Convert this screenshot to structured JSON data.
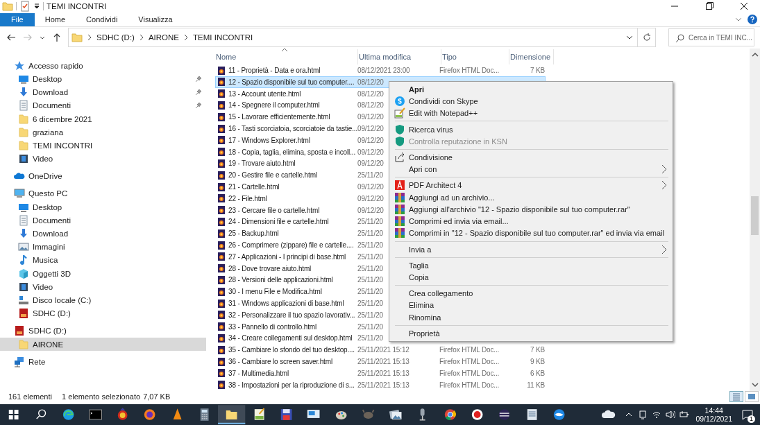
{
  "window": {
    "title": "TEMI INCONTRI"
  },
  "ribbon_tabs": [
    {
      "label": "File",
      "kind": "file"
    },
    {
      "label": "Home",
      "kind": "tab"
    },
    {
      "label": "Condividi",
      "kind": "tab"
    },
    {
      "label": "Visualizza",
      "kind": "tab"
    }
  ],
  "breadcrumb": [
    "SDHC (D:)",
    "AIRONE",
    "TEMI INCONTRI"
  ],
  "search": {
    "placeholder": "Cerca in TEMI INC..."
  },
  "sidebar": {
    "items": [
      {
        "label": "Accesso rapido",
        "kind": "star",
        "selected": false,
        "children": [
          {
            "label": "Desktop",
            "kind": "desktop",
            "selected": false,
            "pinned": true
          },
          {
            "label": "Download",
            "kind": "download",
            "selected": false,
            "pinned": true
          },
          {
            "label": "Documenti",
            "kind": "documents",
            "selected": false,
            "pinned": true
          },
          {
            "label": "6 dicembre 2021",
            "kind": "folder",
            "selected": false,
            "pinned": false
          },
          {
            "label": "graziana",
            "kind": "folder",
            "selected": false,
            "pinned": false
          },
          {
            "label": "TEMI INCONTRI",
            "kind": "folder",
            "selected": false,
            "pinned": false
          },
          {
            "label": "Video",
            "kind": "video",
            "selected": false,
            "pinned": false
          }
        ]
      },
      {
        "label": "OneDrive",
        "kind": "cloud",
        "selected": false
      },
      {
        "label": "Questo PC",
        "kind": "pc",
        "selected": false,
        "children": [
          {
            "label": "Desktop",
            "kind": "desktop",
            "selected": false
          },
          {
            "label": "Documenti",
            "kind": "documents",
            "selected": false
          },
          {
            "label": "Download",
            "kind": "download",
            "selected": false
          },
          {
            "label": "Immagini",
            "kind": "pictures",
            "selected": false
          },
          {
            "label": "Musica",
            "kind": "music",
            "selected": false
          },
          {
            "label": "Oggetti 3D",
            "kind": "cube",
            "selected": false
          },
          {
            "label": "Video",
            "kind": "video",
            "selected": false
          },
          {
            "label": "Disco locale (C:)",
            "kind": "disk",
            "selected": false
          },
          {
            "label": "SDHC (D:)",
            "kind": "sd",
            "selected": false
          }
        ]
      },
      {
        "label": "SDHC (D:)",
        "kind": "sd",
        "selected": false,
        "children": [
          {
            "label": "AIRONE",
            "kind": "folder",
            "selected": true
          }
        ]
      },
      {
        "label": "Rete",
        "kind": "network",
        "selected": false
      }
    ]
  },
  "table": {
    "columns": [
      "Nome",
      "Ultima modifica",
      "Tipo",
      "Dimensione"
    ],
    "rows": [
      {
        "name": "11 - Proprietà - Data e ora.html",
        "modified": "08/12/2021 23:00",
        "type": "Firefox HTML Doc...",
        "size": "7 KB",
        "selected": false
      },
      {
        "name": "12 - Spazio disponibile sul tuo computer....",
        "modified": "08/12/20",
        "selected": true
      },
      {
        "name": "13 - Account utente.html",
        "modified": "08/12/20",
        "selected": false
      },
      {
        "name": "14 - Spegnere il computer.html",
        "modified": "08/12/20",
        "selected": false
      },
      {
        "name": "15 - Lavorare efficientemente.html",
        "modified": "09/12/20",
        "selected": false
      },
      {
        "name": "16 - Tasti scorciatoia, scorciatoie da tastie...",
        "modified": "09/12/20",
        "selected": false
      },
      {
        "name": "17 - Windows Explorer.html",
        "modified": "09/12/20",
        "selected": false
      },
      {
        "name": "18 - Copia, taglia, elimina, sposta e incoll...",
        "modified": "09/12/20",
        "selected": false
      },
      {
        "name": "19 - Trovare aiuto.html",
        "modified": "09/12/20",
        "selected": false
      },
      {
        "name": "20 - Gestire file e cartelle.html",
        "modified": "25/11/20",
        "selected": false
      },
      {
        "name": "21 - Cartelle.html",
        "modified": "09/12/20",
        "selected": false
      },
      {
        "name": "22 - File.html",
        "modified": "09/12/20",
        "selected": false
      },
      {
        "name": "23 - Cercare file o cartelle.html",
        "modified": "09/12/20",
        "selected": false
      },
      {
        "name": "24 - Dimensioni file e cartelle.html",
        "modified": "25/11/20",
        "selected": false
      },
      {
        "name": "25 - Backup.html",
        "modified": "25/11/20",
        "selected": false
      },
      {
        "name": "26 - Comprimere (zippare) file e cartelle....",
        "modified": "25/11/20",
        "selected": false
      },
      {
        "name": "27 - Applicazioni - I principi di base.html",
        "modified": "25/11/20",
        "selected": false
      },
      {
        "name": "28 - Dove trovare aiuto.html",
        "modified": "25/11/20",
        "selected": false
      },
      {
        "name": "28 - Versioni delle applicazioni.html",
        "modified": "25/11/20",
        "selected": false
      },
      {
        "name": "30 - I menu File e Modifica.html",
        "modified": "25/11/20",
        "selected": false
      },
      {
        "name": "31 - Windows applicazioni di base.html",
        "modified": "25/11/20",
        "selected": false
      },
      {
        "name": "32 - Personalizzare il tuo spazio lavorativ...",
        "modified": "25/11/20",
        "selected": false
      },
      {
        "name": "33 - Pannello di controllo.html",
        "modified": "25/11/20",
        "selected": false
      },
      {
        "name": "34 - Creare collegamenti sul desktop.html",
        "modified": "25/11/20",
        "selected": false
      },
      {
        "name": "35 - Cambiare lo sfondo del tuo desktop....",
        "modified": "25/11/2021 15:12",
        "type": "Firefox HTML Doc...",
        "size": "7 KB",
        "selected": false
      },
      {
        "name": "36 - Cambiare lo screen saver.html",
        "modified": "25/11/2021 15:13",
        "type": "Firefox HTML Doc...",
        "size": "9 KB",
        "selected": false
      },
      {
        "name": "37 - Multimedia.html",
        "modified": "25/11/2021 15:13",
        "type": "Firefox HTML Doc...",
        "size": "6 KB",
        "selected": false
      },
      {
        "name": "38 - Impostazioni per la riproduzione di s...",
        "modified": "25/11/2021 15:13",
        "type": "Firefox HTML Doc...",
        "size": "11 KB",
        "selected": false
      }
    ]
  },
  "context_menu": {
    "groups": [
      [
        {
          "label": "Apri",
          "kind": "none",
          "bold": true,
          "disabled": false,
          "submenu": false
        },
        {
          "label": "Condividi con Skype",
          "kind": "skype",
          "bold": false,
          "disabled": false,
          "submenu": false
        },
        {
          "label": "Edit with Notepad++",
          "kind": "notepad",
          "bold": false,
          "disabled": false,
          "submenu": false
        }
      ],
      [
        {
          "label": "Ricerca virus",
          "kind": "shield",
          "bold": false,
          "disabled": false,
          "submenu": false
        },
        {
          "label": "Controlla reputazione in KSN",
          "kind": "shield",
          "bold": false,
          "disabled": true,
          "submenu": false
        }
      ],
      [
        {
          "label": "Condivisione",
          "kind": "share",
          "bold": false,
          "disabled": false,
          "submenu": false
        },
        {
          "label": "Apri con",
          "kind": "none",
          "bold": false,
          "disabled": false,
          "submenu": true
        }
      ],
      [
        {
          "label": "PDF Architect 4",
          "kind": "pdf",
          "bold": false,
          "disabled": false,
          "submenu": true
        },
        {
          "label": "Aggiungi ad un archivio...",
          "kind": "archive",
          "bold": false,
          "disabled": false,
          "submenu": false
        },
        {
          "label": "Aggiungi all'archivio \"12 - Spazio disponibile sul tuo computer.rar\"",
          "kind": "archive",
          "bold": false,
          "disabled": false,
          "submenu": false
        },
        {
          "label": "Comprimi ed invia via email...",
          "kind": "archive",
          "bold": false,
          "disabled": false,
          "submenu": false
        },
        {
          "label": "Comprimi in \"12 - Spazio disponibile sul tuo computer.rar\" ed invia via email",
          "kind": "archive",
          "bold": false,
          "disabled": false,
          "submenu": false
        }
      ],
      [
        {
          "label": "Invia a",
          "kind": "none",
          "bold": false,
          "disabled": false,
          "submenu": true
        }
      ],
      [
        {
          "label": "Taglia",
          "kind": "none",
          "bold": false,
          "disabled": false,
          "submenu": false
        },
        {
          "label": "Copia",
          "kind": "none",
          "bold": false,
          "disabled": false,
          "submenu": false
        }
      ],
      [
        {
          "label": "Crea collegamento",
          "kind": "none",
          "bold": false,
          "disabled": false,
          "submenu": false
        },
        {
          "label": "Elimina",
          "kind": "none",
          "bold": false,
          "disabled": false,
          "submenu": false
        },
        {
          "label": "Rinomina",
          "kind": "none",
          "bold": false,
          "disabled": false,
          "submenu": false
        }
      ],
      [
        {
          "label": "Proprietà",
          "kind": "none",
          "bold": false,
          "disabled": false,
          "submenu": false
        }
      ]
    ]
  },
  "status_bar": {
    "count": "161 elementi",
    "selection": "1 elemento selezionato",
    "size": "7,07 KB"
  },
  "taskbar": {
    "apps": [
      {
        "kind": "edge",
        "selected": false
      },
      {
        "kind": "terminal",
        "selected": false
      },
      {
        "kind": "emblem",
        "selected": false
      },
      {
        "kind": "firefox",
        "selected": false
      },
      {
        "kind": "cone",
        "selected": false
      },
      {
        "kind": "calculator",
        "selected": false
      },
      {
        "kind": "folder",
        "selected": true
      },
      {
        "kind": "notepad",
        "selected": false
      },
      {
        "kind": "floppy",
        "selected": false
      },
      {
        "kind": "monitor",
        "selected": false
      },
      {
        "kind": "palette",
        "selected": false
      },
      {
        "kind": "mascot",
        "selected": false
      },
      {
        "kind": "photos",
        "selected": false
      },
      {
        "kind": "microphone",
        "selected": false
      },
      {
        "kind": "chrome",
        "selected": false
      },
      {
        "kind": "record",
        "selected": false
      },
      {
        "kind": "eclipse",
        "selected": false
      },
      {
        "kind": "document",
        "selected": false
      },
      {
        "kind": "swirl",
        "selected": false
      }
    ],
    "time": "14:44",
    "date": "09/12/2021",
    "notifications": "1"
  }
}
